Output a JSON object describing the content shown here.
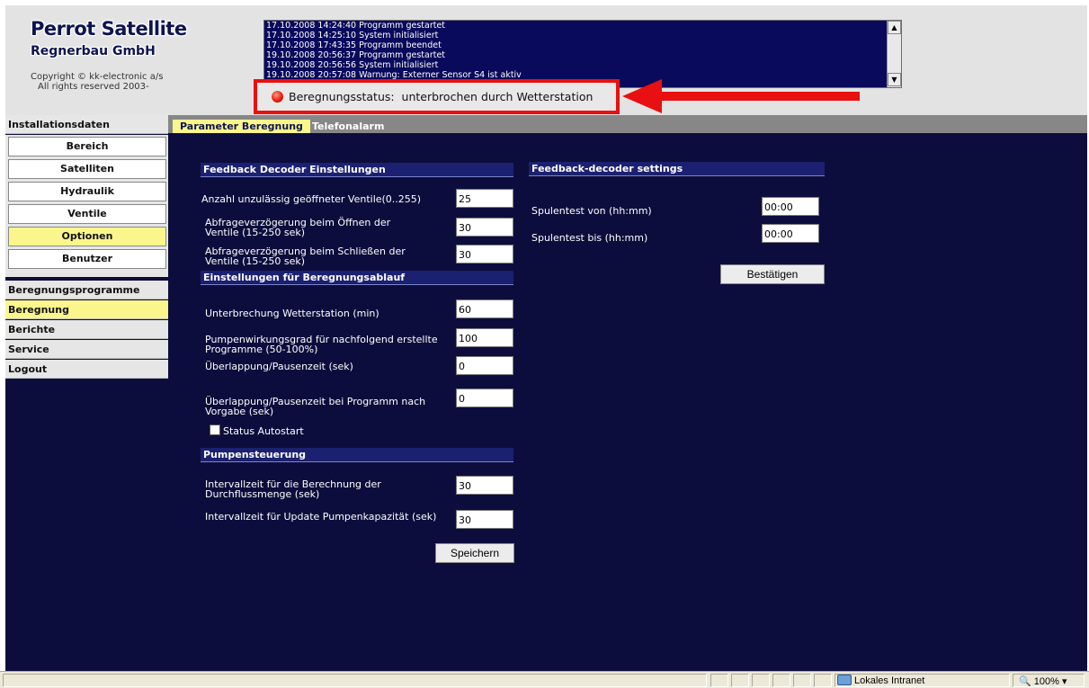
{
  "header": {
    "brand_line1": "Perrot Satellite",
    "brand_line2": "Regnerbau GmbH",
    "copyright_line1": "Copyright © kk-electronic a/s",
    "copyright_line2": "All rights reserved 2003-"
  },
  "log": {
    "lines": [
      "17.10.2008 14:24:40 Programm gestartet",
      "17.10.2008 14:25:10 System initialisiert",
      "17.10.2008 17:43:35 Programm beendet",
      "19.10.2008 20:56:37 Programm gestartet",
      "19.10.2008 20:56:56 System initialisiert",
      "19.10.2008 20:57:08 Warnung: Externer Sensor S4 ist aktiv"
    ]
  },
  "status": {
    "label": "Beregnungsstatus:",
    "value": "unterbrochen durch Wetterstation",
    "indicator_color": "#e81e0a",
    "annotation_color": "#e81010"
  },
  "sidebar": {
    "installation_header": "Installationsdaten",
    "sub_items": [
      "Bereich",
      "Satelliten",
      "Hydraulik",
      "Ventile",
      "Optionen",
      "Benutzer"
    ],
    "active_sub_item": "Optionen",
    "nav_items": [
      "Beregnungsprogramme",
      "Beregnung",
      "Berichte",
      "Service",
      "Logout"
    ],
    "active_nav_item": "Beregnung"
  },
  "tabs": {
    "tab1": "Parameter Beregnung",
    "tab2": "Telefonalarm"
  },
  "feedback": {
    "title": "Feedback Decoder Einstellungen",
    "anzahl_label": "Anzahl unzulässig geöffneter Ventile(0..255)",
    "anzahl_value": "25",
    "oeffnen_label_1": "Abfrageverzögerung beim Öffnen der",
    "oeffnen_label_2": "Ventile (15-250 sek)",
    "oeffnen_value": "30",
    "schliessen_label_1": "Abfrageverzögerung beim Schließen der",
    "schliessen_label_2": "Ventile (15-250 sek)",
    "schliessen_value": "30"
  },
  "ablauf": {
    "title": "Einstellungen für Beregnungsablauf",
    "wetter_label": "Unterbrechung Wetterstation (min)",
    "wetter_value": "60",
    "pumpen_label_1": "Pumpenwirkungsgrad für nachfolgend erstellte",
    "pumpen_label_2": "Programme (50-100%)",
    "pumpen_value": "100",
    "pause_label": "Überlappung/Pausenzeit (sek)",
    "pause_value": "0",
    "pause_vorgabe_label_1": "Überlappung/Pausenzeit bei Programm nach",
    "pause_vorgabe_label_2": "Vorgabe (sek)",
    "pause_vorgabe_value": "0",
    "autostart_label": "Status Autostart"
  },
  "pumpen": {
    "title": "Pumpensteuerung",
    "intervall1_label_1": "Intervallzeit für die Berechnung der",
    "intervall1_label_2": "Durchflussmenge (sek)",
    "intervall1_value": "30",
    "intervall2_label": "Intervallzeit für Update Pumpenkapazität (sek)",
    "intervall2_value": "30",
    "save_button": "Speichern"
  },
  "feedback_settings": {
    "title": "Feedback-decoder settings",
    "von_label": "Spulentest von (hh:mm)",
    "von_value": "00:00",
    "bis_label": "Spulentest bis (hh:mm)",
    "bis_value": "00:00",
    "confirm_button": "Bestätigen"
  },
  "browser_status": {
    "zone": "Lokales Intranet",
    "zoom": "100%"
  }
}
